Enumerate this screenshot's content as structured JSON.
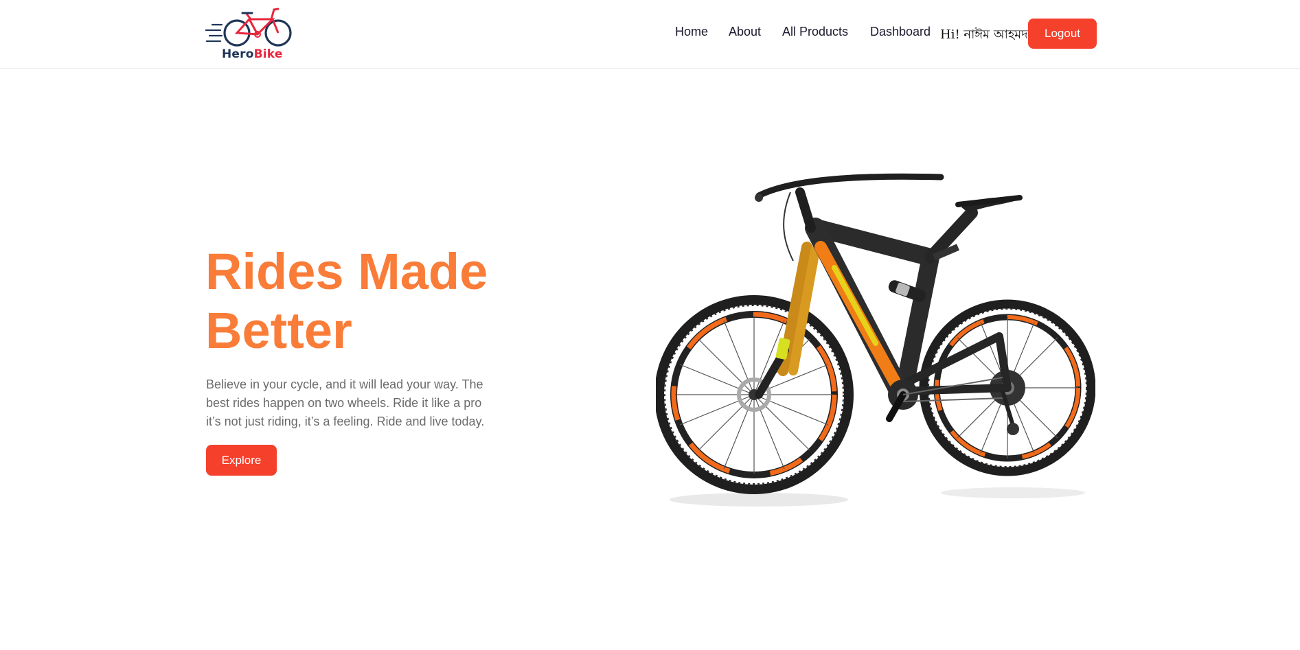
{
  "brand": {
    "name_part1": "Hero",
    "name_part2": "Bike",
    "logo_icon": "bicycle-logo-icon",
    "colors": {
      "navy": "#1e3557",
      "red": "#e8253c"
    }
  },
  "nav": {
    "links": [
      "Home",
      "About",
      "All Products",
      "Dashboard"
    ],
    "greeting": "Hi! নাঈম আহমদ",
    "logout_label": "Logout"
  },
  "hero": {
    "title_line1": "Rides Made",
    "title_line2": "Better",
    "description": "Believe in your cycle, and it will lead your way. The best rides happen on two wheels. Ride it like a pro it’s not just riding, it’s a feeling. Ride and live today.",
    "explore_label": "Explore",
    "image": "mountain-bike-image"
  },
  "colors": {
    "accent_orange": "#f97c38",
    "button_red": "#f5402c",
    "text_gray": "#6b6b6b"
  }
}
